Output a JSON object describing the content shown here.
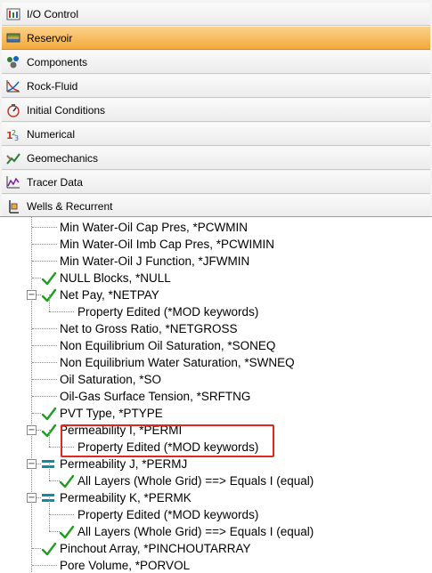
{
  "nav": {
    "items": [
      {
        "label": "I/O Control",
        "icon": "io-control-icon",
        "active": false
      },
      {
        "label": "Reservoir",
        "icon": "reservoir-icon",
        "active": true
      },
      {
        "label": "Components",
        "icon": "components-icon",
        "active": false
      },
      {
        "label": "Rock-Fluid",
        "icon": "rock-fluid-icon",
        "active": false
      },
      {
        "label": "Initial Conditions",
        "icon": "initial-conditions-icon",
        "active": false
      },
      {
        "label": "Numerical",
        "icon": "numerical-icon",
        "active": false
      },
      {
        "label": "Geomechanics",
        "icon": "geomechanics-icon",
        "active": false
      },
      {
        "label": "Tracer Data",
        "icon": "tracer-data-icon",
        "active": false
      },
      {
        "label": "Wells & Recurrent",
        "icon": "wells-recurrent-icon",
        "active": false
      }
    ]
  },
  "tree": {
    "items": [
      {
        "label": "Min Water-Oil Cap Pres, *PCWMIN",
        "depth": 1,
        "status": "none",
        "expander": ""
      },
      {
        "label": "Min Water-Oil Imb Cap Pres, *PCWIMIN",
        "depth": 1,
        "status": "none",
        "expander": ""
      },
      {
        "label": "Min Water-Oil J Function, *JFWMIN",
        "depth": 1,
        "status": "none",
        "expander": ""
      },
      {
        "label": "NULL Blocks, *NULL",
        "depth": 1,
        "status": "check",
        "expander": ""
      },
      {
        "label": "Net Pay, *NETPAY",
        "depth": 1,
        "status": "check",
        "expander": "−"
      },
      {
        "label": "Property Edited (*MOD keywords)",
        "depth": 2,
        "status": "none",
        "expander": ""
      },
      {
        "label": "Net to Gross Ratio, *NETGROSS",
        "depth": 1,
        "status": "none",
        "expander": ""
      },
      {
        "label": "Non Equilibrium Oil Saturation, *SONEQ",
        "depth": 1,
        "status": "none",
        "expander": ""
      },
      {
        "label": "Non Equilibrium Water Saturation, *SWNEQ",
        "depth": 1,
        "status": "none",
        "expander": ""
      },
      {
        "label": "Oil Saturation, *SO",
        "depth": 1,
        "status": "none",
        "expander": ""
      },
      {
        "label": "Oil-Gas Surface Tension, *SRFTNG",
        "depth": 1,
        "status": "none",
        "expander": ""
      },
      {
        "label": "PVT Type, *PTYPE",
        "depth": 1,
        "status": "check",
        "expander": ""
      },
      {
        "label": "Permeability I, *PERMI",
        "depth": 1,
        "status": "check",
        "expander": "−"
      },
      {
        "label": "Property Edited (*MOD keywords)",
        "depth": 2,
        "status": "none",
        "expander": ""
      },
      {
        "label": "Permeability J, *PERMJ",
        "depth": 1,
        "status": "equal",
        "expander": "−"
      },
      {
        "label": "All Layers (Whole Grid) ==> Equals I (equal)",
        "depth": 2,
        "status": "check",
        "expander": ""
      },
      {
        "label": "Permeability K, *PERMK",
        "depth": 1,
        "status": "equal",
        "expander": "−"
      },
      {
        "label": "Property Edited (*MOD keywords)",
        "depth": 2,
        "status": "none",
        "expander": ""
      },
      {
        "label": "All Layers (Whole Grid) ==> Equals I (equal)",
        "depth": 2,
        "status": "check",
        "expander": ""
      },
      {
        "label": "Pinchout Array, *PINCHOUTARRAY",
        "depth": 1,
        "status": "check",
        "expander": ""
      },
      {
        "label": "Pore Volume, *PORVOL",
        "depth": 1,
        "status": "none",
        "expander": ""
      }
    ]
  },
  "colors": {
    "active_nav": "#f2a93b",
    "check": "#1f9d1f",
    "equal": "#0e8f9e",
    "highlight": "#e0281f"
  }
}
